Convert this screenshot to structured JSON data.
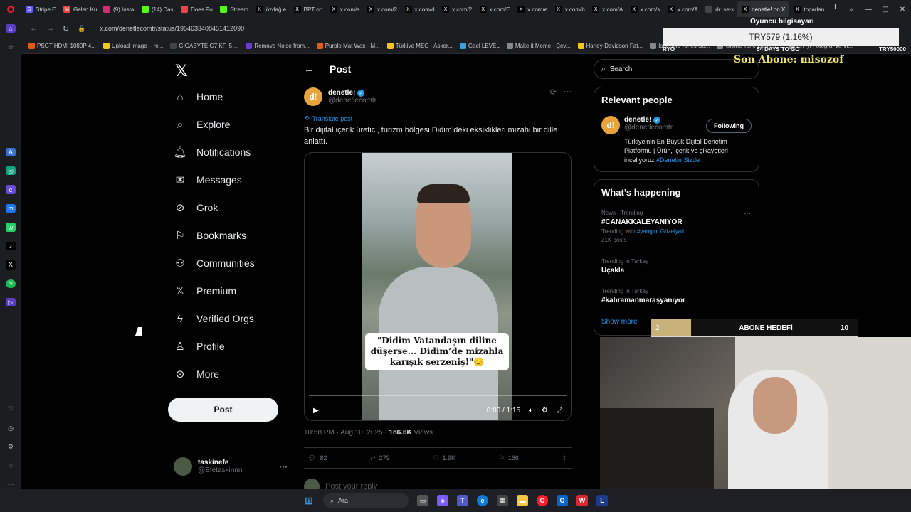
{
  "browser": {
    "tabs": [
      "Stripe E",
      "Gelen Ku",
      "(9) Insta",
      "(14) Das",
      "Does Po",
      "Stream",
      "özdağ e",
      "BPT on",
      "x.com/s",
      "x.com/2",
      "x.com/d",
      "x.com/2",
      "x.com/E",
      "x.com/e",
      "x.com/b",
      "x.com/A",
      "x.com/s",
      "x.com/A",
      "dr. serk",
      "denetle! on X:",
      "toparlan"
    ],
    "url": "x.com/denetlecomtr/status/1954633408451412090",
    "bookmarks": [
      "PSGT HDMI 1080P 4...",
      "Upload Image – re...",
      "GIGABYTE G7 KF i5-...",
      "Remove Noise from...",
      "Purple Mat Wax - M...",
      "Türkiye MEG - Asker...",
      "Gael LEVEL",
      "Make it Meme - Çev...",
      "Harley-Davidson Fat...",
      "Isotropic Tones So...",
      "Online Tone Genera...",
      "En İyi Fotoğraf ve Vi..."
    ]
  },
  "nav": {
    "items": [
      "Home",
      "Explore",
      "Notifications",
      "Messages",
      "Grok",
      "Bookmarks",
      "Communities",
      "Premium",
      "Verified Orgs",
      "Profile",
      "More"
    ],
    "post_button": "Post",
    "user_name": "taskinefe",
    "user_handle": "@Efetaskinnn"
  },
  "post": {
    "header_title": "Post",
    "author_name": "denetle!",
    "author_handle": "@denetlecomtr",
    "translate": "Translate post",
    "text": "Bir dijital içerik üretici, turizm bölgesi Didim’deki eksiklikleri mizahi bir dille anlattı.",
    "video_caption": "\"Didim Vatandaşın diline düşerse... Didim’de mizahla karışık serzeniş!\"😊",
    "video_time": "0:00 / 1:15",
    "timestamp": "10:58 PM · Aug 10, 2025 · ",
    "views_count": "186.6K",
    "views_label": " Views",
    "replies": "82",
    "reposts": "279",
    "likes": "1.9K",
    "bookmarks": "166",
    "reply_placeholder": "Post your reply"
  },
  "right": {
    "search_placeholder": "Search",
    "relevant_title": "Relevant people",
    "rp_name": "denetle!",
    "rp_handle": "@denetlecomtr",
    "rp_follow": "Following",
    "rp_bio": "Türkiye'nin En Büyük Dijital Denetim Platformu | Ürün, içerik ve şikayetleri inceliyoruz ",
    "rp_bio_tag": "#DenetimSizde",
    "happening_title": "What’s happening",
    "trends": [
      {
        "ctx": "News · Trending",
        "name": "#CANAKKALEYANIYOR",
        "sub": "Trending with ",
        "sub_tag": "#yangın, Güzelyalı",
        "posts": "31K posts"
      },
      {
        "ctx": "Trending in Turkey",
        "name": "Uçakla"
      },
      {
        "ctx": "Trending in Turkey",
        "name": "#kahramanmaraşyanıyor"
      }
    ],
    "show_more": "Show more"
  },
  "overlay": {
    "top_label": "Oyuncu bilgisayarı",
    "price_box": "TRY579 (1.16%)",
    "left_small": "RYO",
    "mid_small": "54 DAYS TO GO",
    "right_small": "TRY50000",
    "abone": "Son Abone: misozof",
    "goal_current": "2",
    "goal_label": "ABONE HEDEFİ",
    "goal_target": "10"
  },
  "taskbar": {
    "search": "Ara"
  }
}
